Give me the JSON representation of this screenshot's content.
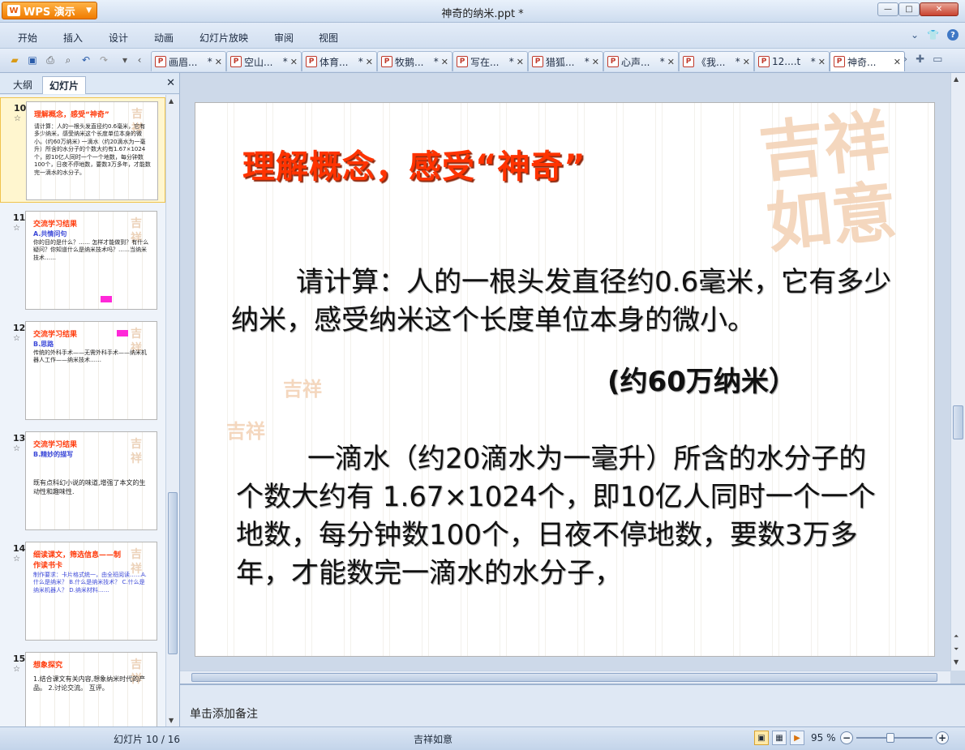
{
  "app": {
    "name": "WPS 演示",
    "logo": "W",
    "document_title": "神奇的纳米.ppt *"
  },
  "menu": [
    "开始",
    "插入",
    "设计",
    "动画",
    "幻灯片放映",
    "审阅",
    "视图"
  ],
  "doc_tabs": [
    {
      "label": "画眉..."
    },
    {
      "label": "空山..."
    },
    {
      "label": "体育..."
    },
    {
      "label": "牧鹅..."
    },
    {
      "label": "写在..."
    },
    {
      "label": "猎狐..."
    },
    {
      "label": "心声..."
    },
    {
      "label": "《我..."
    },
    {
      "label": "12....t"
    },
    {
      "label": "神奇..."
    }
  ],
  "tab_marks": {
    "modified": "*",
    "close": "✕",
    "ppt_icon": "P"
  },
  "left_panel": {
    "tabs": [
      "大纲",
      "幻灯片"
    ],
    "close": "✕",
    "slides": [
      {
        "num": "10",
        "star": "☆",
        "title": "理解概念，感受“神奇”",
        "body": "请计算：人的一根头发直径约0.6毫米，它有多少纳米，感受纳米这个长度单位本身的微小。(约60万纳米)  一滴水（约20滴水为一毫升）所含的水分子的个数大约有1.67×1024个，即10亿人同时一个一个地数，每分钟数100个，日夜不停地数，要数3万多年，才能数完一滴水的水分子。"
      },
      {
        "num": "11",
        "star": "☆",
        "title": "交流学习结果",
        "sub": "A.共情问句",
        "body": "你的目的是什么？…… 怎样才能做到？有什么疑问？你知道什么是纳米技术吗？……当纳米技术……"
      },
      {
        "num": "12",
        "star": "☆",
        "title": "交流学习结果",
        "sub": "B.思路",
        "body": "传统的外科手术——无需外科手术——纳米机器人工作——纳米技术……"
      },
      {
        "num": "13",
        "star": "☆",
        "title": "交流学习结果",
        "sub": "B.精妙的描写",
        "body": "既有点科幻小说的味道,增强了本文的生动性和趣味性."
      },
      {
        "num": "14",
        "star": "☆",
        "title": "细读课文，筛选信息——制作读书卡",
        "body": "制作要求：卡片格式统一，由全班阅读……A.什么是纳米？ B.什么是纳米技术？ C.什么是纳米机器人？ D.纳米材料……"
      },
      {
        "num": "15",
        "star": "☆",
        "title": "想象探究",
        "body": "1.结合课文有关内容,想象纳米时代的产品。  2.讨论交流。 互评。"
      }
    ]
  },
  "slide": {
    "title": "理解概念，感受“神奇”",
    "para1": "请计算：人的一根头发直径约0.6毫米，它有多少纳米，感受纳米这个长度单位本身的微小。",
    "answer": "(约60万纳米）",
    "para2": "一滴水（约20滴水为一毫升）所含的水分子的个数大约有 1.67×1024个，即10亿人同时一个一个地数，每分钟数100个，日夜不停地数，要数3万多年，才能数完一滴水的水分子，",
    "deco_text": "吉祥如意"
  },
  "notes": {
    "placeholder": "单击添加备注"
  },
  "status": {
    "slide_counter": "幻灯片 10 / 16",
    "theme": "吉祥如意",
    "zoom": "95 %",
    "zoom_level": 0.45
  }
}
